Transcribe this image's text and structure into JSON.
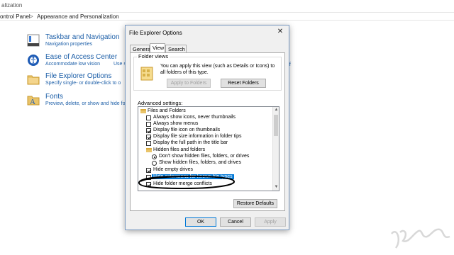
{
  "window": {
    "title_partial": "alization"
  },
  "address": {
    "crumb1": "ontrol Panel",
    "sep1": ">",
    "crumb2": "Appearance and Personalization"
  },
  "control_panel": {
    "items": [
      {
        "title": "Taskbar and Navigation",
        "sub": "Navigation properties",
        "sub2": "",
        "icon": "taskbar-icon"
      },
      {
        "title": "Ease of Access Center",
        "sub": "Accommodate low vision",
        "sub2": "Use s",
        "icon": "ease-of-access-icon"
      },
      {
        "title": "File Explorer Options",
        "sub": "Specify single- or double-click to o",
        "sub2": "",
        "icon": "folder-options-icon"
      },
      {
        "title": "Fonts",
        "sub": "Preview, delete, or show and hide fo",
        "sub2": "",
        "icon": "fonts-icon"
      }
    ],
    "partial_right": "ff"
  },
  "dialog": {
    "title": "File Explorer Options",
    "close": "✕",
    "tabs": [
      "General",
      "View",
      "Search"
    ],
    "active_tab": "View",
    "folder_views": {
      "label": "Folder views",
      "text": "You can apply this view (such as Details or Icons) to all folders of this type.",
      "apply_button": "Apply to Folders",
      "reset_button": "Reset Folders"
    },
    "advanced_label": "Advanced settings:",
    "tree": [
      {
        "kind": "folder",
        "label": "Files and Folders",
        "checked": false,
        "indent": 0
      },
      {
        "kind": "checkbox",
        "label": "Always show icons, never thumbnails",
        "checked": false,
        "indent": 1
      },
      {
        "kind": "checkbox",
        "label": "Always show menus",
        "checked": false,
        "indent": 1
      },
      {
        "kind": "checkbox",
        "label": "Display file icon on thumbnails",
        "checked": true,
        "indent": 1
      },
      {
        "kind": "checkbox",
        "label": "Display file size information in folder tips",
        "checked": true,
        "indent": 1
      },
      {
        "kind": "checkbox",
        "label": "Display the full path in the title bar",
        "checked": false,
        "indent": 1
      },
      {
        "kind": "folder",
        "label": "Hidden files and folders",
        "checked": false,
        "indent": 1
      },
      {
        "kind": "radio",
        "label": "Don't show hidden files, folders, or drives",
        "checked": true,
        "indent": 2
      },
      {
        "kind": "radio",
        "label": "Show hidden files, folders, and drives",
        "checked": false,
        "indent": 2
      },
      {
        "kind": "checkbox",
        "label": "Hide empty drives",
        "checked": true,
        "indent": 1
      },
      {
        "kind": "checkbox",
        "label": "Hide extensions for known file types",
        "checked": false,
        "indent": 1,
        "selected": true
      },
      {
        "kind": "checkbox",
        "label": "Hide folder merge conflicts",
        "checked": true,
        "indent": 1
      }
    ],
    "restore_button": "Restore Defaults",
    "ok_button": "OK",
    "cancel_button": "Cancel",
    "apply_button": "Apply"
  },
  "colors": {
    "link": "#1d5fa8",
    "selection": "#0078d7",
    "scribble": "#000000"
  }
}
